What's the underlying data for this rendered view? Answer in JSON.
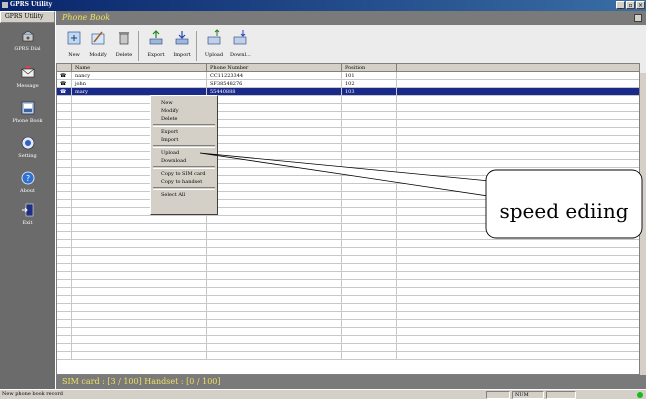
{
  "window": {
    "title": "GPRS Utility",
    "controls": [
      "_",
      "▫",
      "×"
    ]
  },
  "sidebar": {
    "header": "GPRS Utility",
    "items": [
      {
        "label": "GPRS Dial",
        "icon": "phone-icon"
      },
      {
        "label": "Message",
        "icon": "envelope-icon"
      },
      {
        "label": "Phone Book",
        "icon": "phonebook-icon"
      },
      {
        "label": "Setting",
        "icon": "gear-icon"
      },
      {
        "label": "About",
        "icon": "help-icon"
      },
      {
        "label": "Exit",
        "icon": "exit-icon"
      }
    ]
  },
  "header": {
    "title": "Phone Book"
  },
  "toolbar": {
    "new": "New",
    "modify": "Modify",
    "delete": "Delete",
    "export": "Export",
    "import": "Import",
    "upload": "Upload",
    "download": "Downl..."
  },
  "table": {
    "columns": [
      "",
      "Name",
      "Phone Number",
      "Position",
      ""
    ],
    "rows": [
      {
        "name": "nancy",
        "phone": "CC11223344",
        "position": "101"
      },
      {
        "name": "john",
        "phone": "SF38548276",
        "position": "102"
      },
      {
        "name": "mary",
        "phone": "55440888",
        "position": "103"
      }
    ]
  },
  "context_menu": {
    "new": "New",
    "modify": "Modify",
    "delete": "Delete",
    "export": "Export",
    "import": "Import",
    "upload": "Upload",
    "download": "Download",
    "copy_sim": "Copy to SIM card",
    "copy_handset": "Copy to handset",
    "select_all": "Select All"
  },
  "simbar": {
    "text": "SIM card : [3 / 100]   Handset : [0 / 100]"
  },
  "statusbar": {
    "message": "New phone book record",
    "mode": "NUM"
  },
  "callout": {
    "text": "speed ediing"
  },
  "colors": {
    "selection": "#1a2a8a",
    "header_text": "#f0e060",
    "led": "#1cb81c"
  }
}
